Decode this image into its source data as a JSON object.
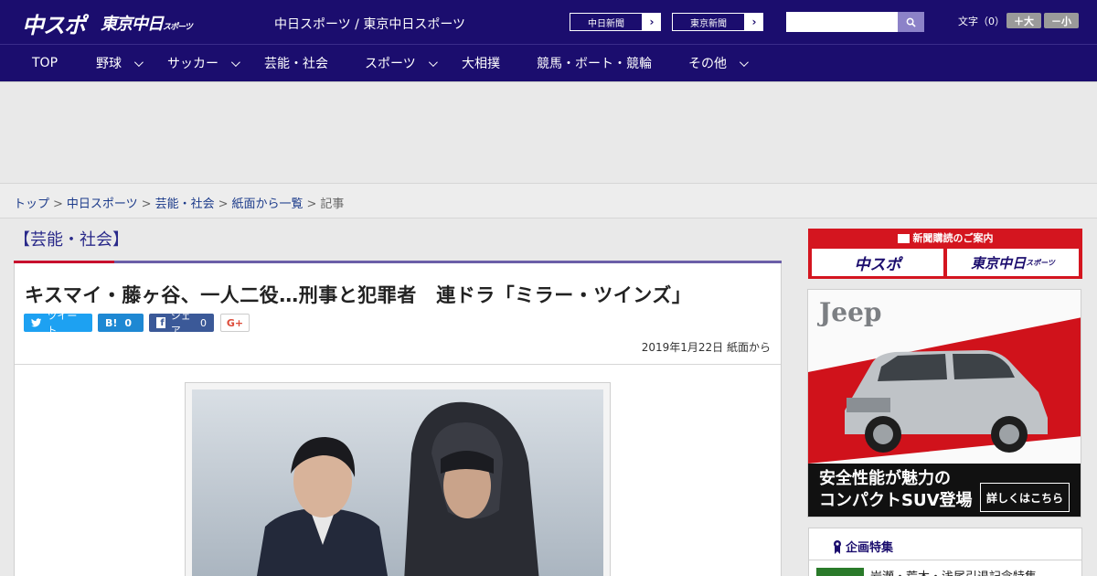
{
  "header": {
    "logo_chuspo": "中スポ",
    "logo_tokyo": "東京中日",
    "logo_tokyo_small": "スポーツ",
    "site_link": "中日スポーツ / 東京中日スポーツ",
    "chunichi_shimbun": "中日新聞",
    "tokyo_shimbun": "東京新聞",
    "search_placeholder": "",
    "moji_label": "文字（0）",
    "size_up": "＋大",
    "size_down": "－小"
  },
  "nav": {
    "items": [
      "TOP",
      "野球",
      "サッカー",
      "芸能・社会",
      "スポーツ",
      "大相撲",
      "競馬・ボート・競輪",
      "その他"
    ]
  },
  "breadcrumb": {
    "items": [
      "トップ",
      "中日スポーツ",
      "芸能・社会",
      "紙面から一覧"
    ],
    "current": "記事",
    "separator": ">"
  },
  "article": {
    "category": "【芸能・社会】",
    "headline": "キスマイ・藤ヶ谷、一人二役…刑事と犯罪者　連ドラ「ミラー・ツインズ」",
    "share": {
      "tweet": "ツイート",
      "hatena_label": "B!",
      "hatena_count": "0",
      "facebook": "シェア",
      "facebook_count": "0",
      "gplus": "G+"
    },
    "date": "2019年1月22日 紙面から"
  },
  "sidebar": {
    "subscription_title": "新聞購読のご案内",
    "sub_logo_1": "中スポ",
    "sub_logo_2": "東京中日",
    "sub_logo_2_small": "スポーツ",
    "ad_brand": "Jeep",
    "ad_copy_line1": "安全性能が魅力の",
    "ad_copy_line2": "コンパクトSUV登場",
    "ad_cta": "詳しくはこちら",
    "feature_title": "企画特集",
    "feature_item": "岩瀬・荒木・浅尾引退記念特集"
  },
  "colors": {
    "brand_navy": "#1b0d6e",
    "accent_red": "#c8102e",
    "link_blue": "#1b3a8a"
  }
}
